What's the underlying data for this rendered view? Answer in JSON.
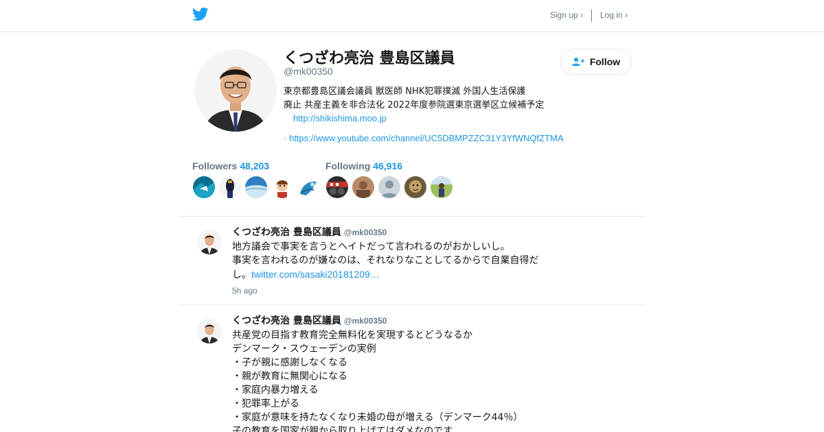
{
  "header": {
    "brand_icon": "twitter-bird-icon",
    "signup_label": "Sign up ›",
    "login_label": "Log in ›",
    "accent_color": "#1da1f2"
  },
  "profile": {
    "name": "くつざわ亮治 豊島区議員",
    "handle": "@mk00350",
    "follow_label": "Follow",
    "bio_line1": "東京都豊島区議会議員 獣医師 NHK犯罪撲滅 外国人生活保護",
    "bio_line2": "廃止 共産主義を非合法化 2022年度参院選東京選挙区立候補予定",
    "url": "http://shikishima.moo.jp",
    "youtube_prefix": "·",
    "youtube_url": "https://www.youtube.com/channel/UC5DBMPZZC31Y3YfWNQfZTMA"
  },
  "stats": {
    "followers_label": "Followers",
    "followers_count": "48,203",
    "following_label": "Following",
    "following_count": "46,916"
  },
  "tweets": [
    {
      "name": "くつざわ亮治 豊島区議員",
      "handle": "@mk00350",
      "lines": [
        "地方議会で事実を言うとヘイトだって言われるのがおかしいし。",
        "事実を言われるのが嫌なのは、それなりなことしてるからで自業自得だ"
      ],
      "last_line_prefix": "し。",
      "link": "twitter.com/sasaki20181209…",
      "time": "5h ago"
    },
    {
      "name": "くつざわ亮治 豊島区議員",
      "handle": "@mk00350",
      "lines": [
        "共産党の目指す教育完全無料化を実現するとどうなるか",
        "デンマーク・スウェーデンの実例",
        "・子が親に感謝しなくなる",
        "・親が教育に無関心になる",
        "・家庭内暴力増える",
        "・犯罪率上がる",
        "・家庭が意味を持たなくなり未婚の母が増える（デンマーク44％）",
        "子の教育を国家が親から取り上げてはダメなのです"
      ]
    }
  ]
}
